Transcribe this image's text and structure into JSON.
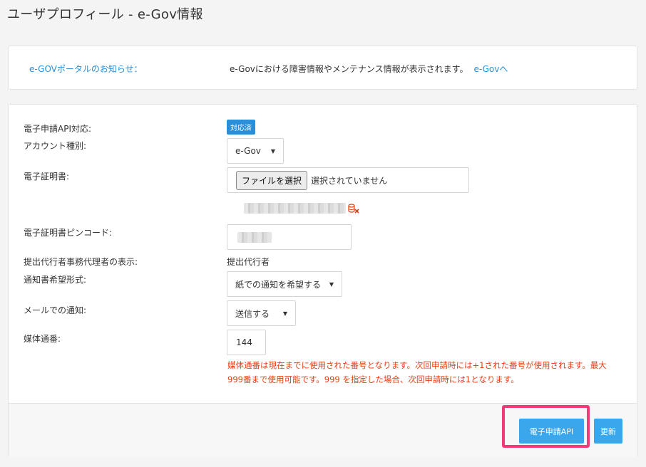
{
  "page": {
    "title": "ユーザプロフィール - e-Gov情報"
  },
  "notice": {
    "label": "e-GOVポータルのお知らせ：",
    "text": "e-Govにおける障害情報やメンテナンス情報が表示されます。",
    "link": "e-Govへ"
  },
  "form": {
    "api_label": "電子申請API対応:",
    "api_badge": "対応済",
    "account_label": "アカウント種別:",
    "account_value": "e-Gov",
    "cert_label": "電子証明書:",
    "file_button": "ファイルを選択",
    "file_status": "選択されていません",
    "pin_label": "電子証明書ピンコード:",
    "agent_label": "提出代行者事務代理者の表示:",
    "agent_value": "提出代行者",
    "notify_format_label": "通知書希望形式:",
    "notify_format_value": "紙での通知を希望する",
    "email_label": "メールでの通知:",
    "email_value": "送信する",
    "media_label": "媒体通番:",
    "media_value": "144",
    "media_help": "媒体通番は現在までに使用された番号となります。次回申請時には+1された番号が使用されます。最大999番まで使用可能です。999 を指定した場合、次回申請時には1となります。"
  },
  "footer": {
    "egov_button": "電子申請API",
    "update_button": "更新"
  },
  "colors": {
    "accent": "#2a8ed8",
    "button": "#3aa6ec",
    "error": "#e33f14",
    "highlight": "#f03a7a"
  }
}
